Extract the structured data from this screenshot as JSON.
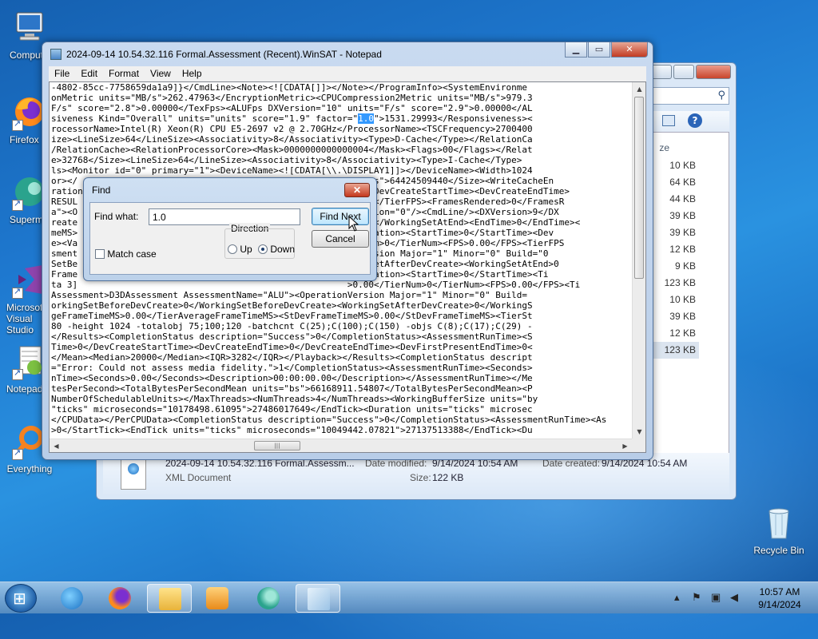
{
  "desktop": {
    "icons": [
      {
        "label": "Computer"
      },
      {
        "label": "Firefox"
      },
      {
        "label": "Supermium"
      },
      {
        "label": "Microsoft Visual Studio"
      },
      {
        "label": "Notepad++"
      },
      {
        "label": "Everything"
      },
      {
        "label": "Recycle Bin"
      }
    ]
  },
  "explorer": {
    "sizes": [
      "10 KB",
      "64 KB",
      "44 KB",
      "39 KB",
      "39 KB",
      "12 KB",
      "9 KB",
      "123 KB",
      "10 KB",
      "39 KB",
      "12 KB",
      "123 KB"
    ],
    "size_header": "ze",
    "details": {
      "filename": "2024-09-14 10.54.32.116 Formal.Assessm...",
      "type": "XML Document",
      "date_modified_label": "Date modified:",
      "date_modified": "9/14/2024 10:54 AM",
      "date_created_label": "Date created:",
      "date_created": "9/14/2024 10:54 AM",
      "size_label": "Size:",
      "size": "122 KB"
    }
  },
  "notepad": {
    "title": "2024-09-14 10.54.32.116 Formal.Assessment (Recent).WinSAT - Notepad",
    "menu": [
      "File",
      "Edit",
      "Format",
      "View",
      "Help"
    ],
    "lines_pre": [
      "-4802-85cc-7758659da1a9]}</CmdLine><Note><![CDATA[]]></Note></ProgramInfo><SystemEnvironme",
      "onMetric units=\"MB/s\">262.47963</EncryptionMetric><CPUCompression2Metric units=\"MB/s\">979.3",
      "F/s\" score=\"2.8\">0.00000</TexFps><ALUFps DXVersion=\"10\" units=\"F/s\" score=\"2.9\">0.00000</AL"
    ],
    "line_hl_before": "siveness Kind=\"Overall\" units=\"units\" score=\"1.9\" factor=\"",
    "line_hl_match": "1.0",
    "line_hl_after": "\">1531.29993</Responsiveness><",
    "lines_post": [
      "rocessorName>Intel(R) Xeon(R) CPU E5-2697 v2 @ 2.70GHz</ProcessorName><TSCFrequency>2700400",
      "ize><LineSize>64</LineSize><Associativity>8</Associativity><Type>D-Cache</Type></RelationCa",
      "/RelationCache><RelationProcessorCore><Mask>0000000000000004</Mask><Flags>00</Flags></Relat",
      "e>32768</Size><LineSize>64</LineSize><Associativity>8</Associativity><Type>I-Cache</Type>",
      "ls><Monitor id=\"0\" primary=\"1\"><DeviceName><![CDATA[\\\\.\\DISPLAY1]]></DeviceName><Width>1024",
      "or></                                                   \"bytes\">64424509440</Size><WriteCacheEn",
      "ration                                                   .0</DevCreateStartTime><DevCreateEndTime>",
      "RESUL                                                    0.00</TierFPS><FramesRendered>0</FramesR",
      "a\"><O                                                   Revision=\"0\"/><CmdLine/><DXVersion>9</DX",
      "reate                                                    0.00</WorkingSetAtEnd><EndTime>0</EndTime><",
      "meMS>                                                   erDuration><StartTime>0</StartTime><Dev",
      "e><Va                                                    erNum>0</TierNum><FPS>0.00</FPS><TierFPS",
      "sment                                                   onVersion Major=\"1\" Minor=\"0\" Build=\"0",
      "SetBe                                                   kingSetAfterDevCreate><WorkingSetAtEnd>0",
      "Frame                                                   erDuration><StartTime>0</StartTime><Ti",
      "ta 3]                                                   >0.00</TierNum>0</TierNum><FPS>0.00</FPS><Ti",
      "Assessment>D3DAssessment AssessmentName=\"ALU\"><OperationVersion Major=\"1\" Minor=\"0\" Build=",
      "orkingSetBeforeDevCreate>0</WorkingSetBeforeDevCreate><WorkingSetAfterDevCreate>0</WorkingS",
      "geFrameTimeMS>0.00</TierAverageFrameTimeMS><StDevFrameTimeMS>0.00</StDevFrameTimeMS><TierSt",
      "80 -height 1024 -totalobj 75;100;120 -batchcnt C(25);C(100);C(150) -objs C(8);C(17);C(29) -",
      "</Results><CompletionStatus description=\"Success\">0</CompletionStatus><AssessmentRunTime><S",
      "Time>0</DevCreateStartTime><DevCreateEndTime>0</DevCreateEndTime><DevFirstPresentEndTime>0<",
      "</Mean><Median>20000</Median><IQR>3282</IQR></Playback></Results><CompletionStatus descript",
      "=\"Error: Could not assess media fidelity.\">1</CompletionStatus><AssessmentRunTime><Seconds>",
      "nTime><Seconds>0.00</Seconds><Description>00:00:00.00</Description></AssessmentRunTime></Me",
      "tesPerSecond><TotalBytesPerSecondMean units=\"bs\">66168911.54807</TotalBytesPerSecondMean><P",
      "NumberOfSchedulableUnits></MaxThreads><NumThreads>4</NumThreads><WorkingBufferSize units=\"by",
      "\"ticks\" microseconds=\"10178498.61095\">27486017649</EndTick><Duration units=\"ticks\" microsec",
      "</CPUData></PerCPUData><CompletionStatus description=\"Success\">0</CompletionStatus><AssessmentRunTime><As",
      ">0</StartTick><EndTick units=\"ticks\" microseconds=\"10049442.07821\">27137513388</EndTick><Du"
    ]
  },
  "find_dialog": {
    "title": "Find",
    "find_what_label": "Find what:",
    "find_what_value": "1.0",
    "find_next_label": "Find Next",
    "cancel_label": "Cancel",
    "direction_label": "Direction",
    "up_label": "Up",
    "down_label": "Down",
    "match_case_label": "Match case",
    "direction_selected": "Down",
    "match_case_checked": false
  },
  "taskbar": {
    "time": "10:57 AM",
    "date": "9/14/2024",
    "pinned": [
      "internet-explorer",
      "firefox",
      "file-explorer",
      "media-player",
      "supermium",
      "notepad"
    ]
  },
  "colors": {
    "selection_highlight": "#3399ff",
    "desktop_blue": "#1e78cf"
  }
}
